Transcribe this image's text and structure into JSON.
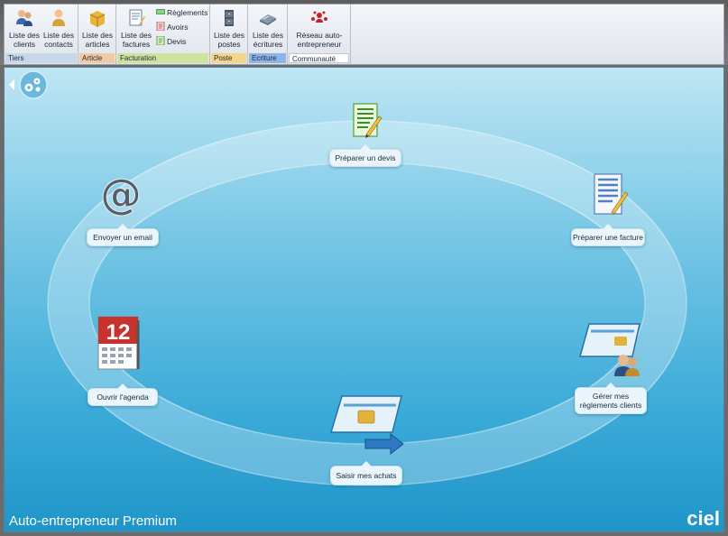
{
  "ribbon": {
    "groups": [
      {
        "label": "Tiers",
        "color": "#c9d7ea",
        "buttons": [
          {
            "label": "Liste des clients"
          },
          {
            "label": "Liste des contacts"
          }
        ]
      },
      {
        "label": "Article",
        "color": "#f2c9a3",
        "buttons": [
          {
            "label": "Liste des articles"
          }
        ]
      },
      {
        "label": "Facturation",
        "color": "#cfe3a0",
        "buttons": [
          {
            "label": "Liste des factures"
          }
        ],
        "small_buttons": [
          {
            "label": "Règlements"
          },
          {
            "label": "Avoirs"
          },
          {
            "label": "Devis"
          }
        ]
      },
      {
        "label": "Poste",
        "color": "#f5d58a",
        "buttons": [
          {
            "label": "Liste des postes"
          }
        ]
      },
      {
        "label": "Ecriture",
        "color": "#8fb4e6",
        "buttons": [
          {
            "label": "Liste des écritures"
          }
        ]
      },
      {
        "label": "Communauté",
        "color": "#ffffff",
        "buttons": [
          {
            "label": "Réseau auto-entrepreneur"
          }
        ]
      }
    ]
  },
  "workflow": {
    "nodes": [
      {
        "label": "Préparer un devis",
        "icon": "quote-icon"
      },
      {
        "label": "Préparer une facture",
        "icon": "invoice-icon"
      },
      {
        "label": "Gérer mes règlements clients",
        "icon": "payments-icon"
      },
      {
        "label": "Saisir mes achats",
        "icon": "purchases-icon"
      },
      {
        "label": "Ouvrir l'agenda",
        "icon": "calendar-icon"
      },
      {
        "label": "Envoyer un email",
        "icon": "email-icon"
      }
    ],
    "calendar_day": "12"
  },
  "footer": {
    "title": "Auto-entrepreneur Premium",
    "brand": "ciel"
  }
}
